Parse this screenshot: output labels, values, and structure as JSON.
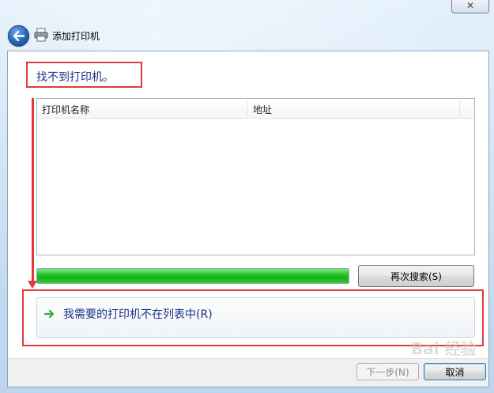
{
  "window": {
    "title": "添加打印机",
    "close_glyph": "✕"
  },
  "heading": "找不到打印机。",
  "list": {
    "columns": [
      "打印机名称",
      "地址"
    ],
    "rows": []
  },
  "progress": {
    "value": 1.0,
    "color": "#22c022"
  },
  "search_again_label": "再次搜索(S)",
  "command_link": {
    "label": "我需要的打印机不在列表中(R)",
    "icon": "green-arrow-icon"
  },
  "footer": {
    "next_label": "下一步(N)",
    "cancel_label": "取消"
  },
  "annotation_color": "#e23a3a",
  "watermark": "Bai 经验"
}
